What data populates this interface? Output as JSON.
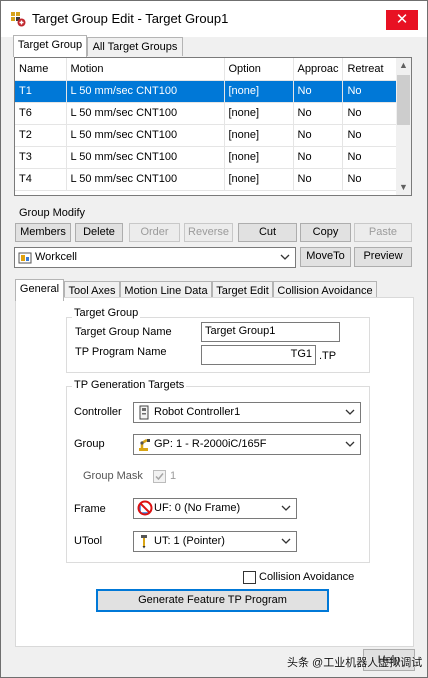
{
  "window": {
    "title": "Target Group Edit - Target Group1",
    "close_symbol": "✕"
  },
  "top_tabs": [
    "Target Group",
    "All Target Groups"
  ],
  "grid": {
    "columns": [
      "Name",
      "Motion",
      "Option",
      "Approac",
      "Retreat"
    ],
    "rows": [
      [
        "T1",
        "L 50 mm/sec CNT100",
        "[none]",
        "No",
        "No"
      ],
      [
        "T6",
        "L 50 mm/sec CNT100",
        "[none]",
        "No",
        "No"
      ],
      [
        "T2",
        "L 50 mm/sec CNT100",
        "[none]",
        "No",
        "No"
      ],
      [
        "T3",
        "L 50 mm/sec CNT100",
        "[none]",
        "No",
        "No"
      ],
      [
        "T4",
        "L 50 mm/sec CNT100",
        "[none]",
        "No",
        "No"
      ]
    ],
    "selected_row": 0
  },
  "group_modify": {
    "label": "Group Modify",
    "buttons": {
      "members": "Members",
      "delete": "Delete",
      "order": "Order",
      "reverse": "Reverse",
      "cut": "Cut",
      "copy": "Copy",
      "paste": "Paste"
    },
    "workcell_value": "Workcell",
    "move_to": "MoveTo",
    "preview": "Preview"
  },
  "sub_tabs": [
    "General",
    "Tool Axes",
    "Motion Line Data",
    "Target Edit",
    "Collision Avoidance"
  ],
  "target_group": {
    "title": "Target Group",
    "name_label": "Target Group Name",
    "name_value": "Target Group1",
    "tp_label": "TP Program Name",
    "tp_value": "TG1",
    "tp_ext": ".TP"
  },
  "tp_generation": {
    "title": "TP Generation Targets",
    "controller_label": "Controller",
    "controller_value": "Robot Controller1",
    "group_label": "Group",
    "group_value": "GP: 1 - R-2000iC/165F",
    "group_mask_label": "Group Mask",
    "group_mask_value": "1",
    "frame_label": "Frame",
    "frame_value": "UF: 0  (No Frame)",
    "utool_label": "UTool",
    "utool_value": "UT: 1  (Pointer)"
  },
  "collision_avoidance_label": "Collision Avoidance",
  "generate_button": "Generate Feature TP Program",
  "help_button": "Help",
  "watermark": "头条 @工业机器人虚拟调试",
  "colors": {
    "selection": "#0078d7",
    "close_button": "#e81123"
  },
  "icons": [
    "app-icon",
    "workcell-icon",
    "controller-icon",
    "robot-icon",
    "no-frame-icon",
    "pointer-tool-icon",
    "chevron-down-icon",
    "checkbox-icon"
  ]
}
